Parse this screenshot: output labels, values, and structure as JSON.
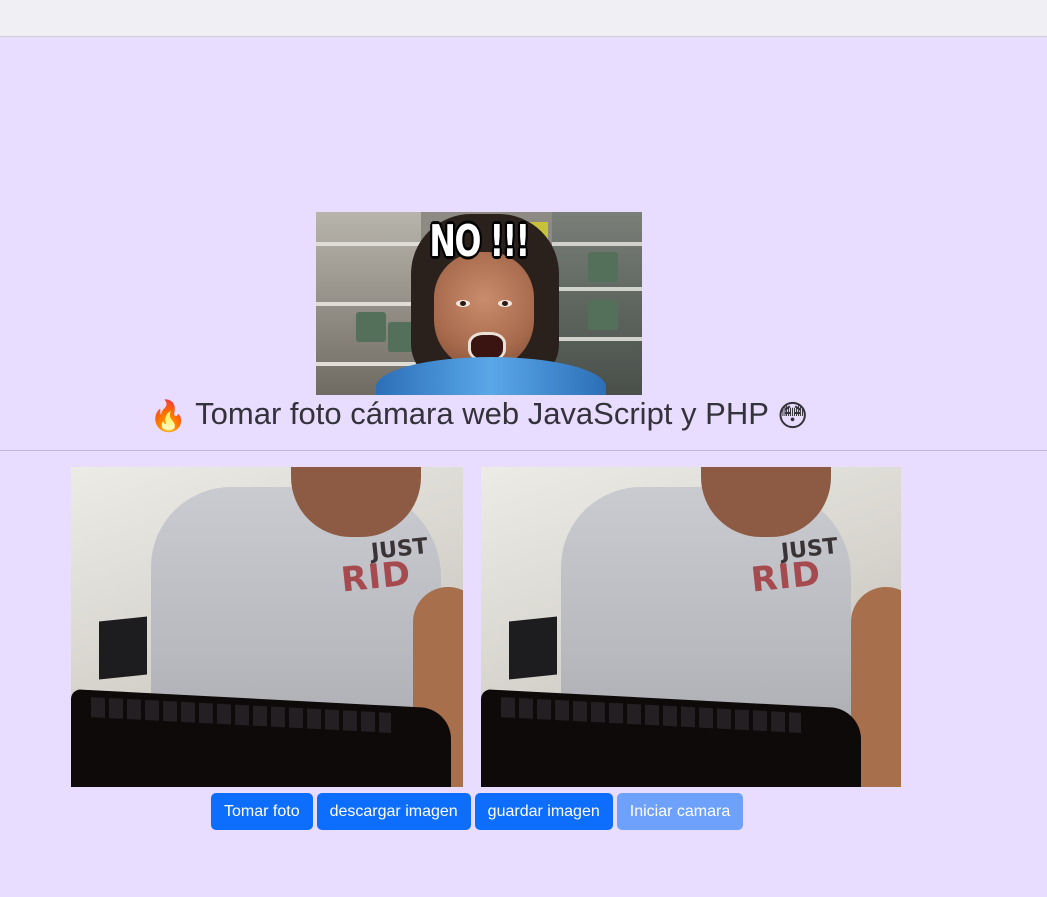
{
  "meme": {
    "caption": "NO !!!"
  },
  "heading": {
    "fire_emoji": "🔥",
    "text": "Tomar foto cámara web JavaScript y PHP",
    "flushed_emoji": "😳"
  },
  "frames": {
    "print_top": "JUST",
    "print_bottom": "RID"
  },
  "buttons": {
    "take_photo": "Tomar foto",
    "download": "descargar imagen",
    "save": "guardar imagen",
    "start_camera": "Iniciar camara"
  },
  "colors": {
    "background": "#e9ddff",
    "button_primary": "#0d6efd",
    "button_disabled": "#6ea1fb"
  }
}
